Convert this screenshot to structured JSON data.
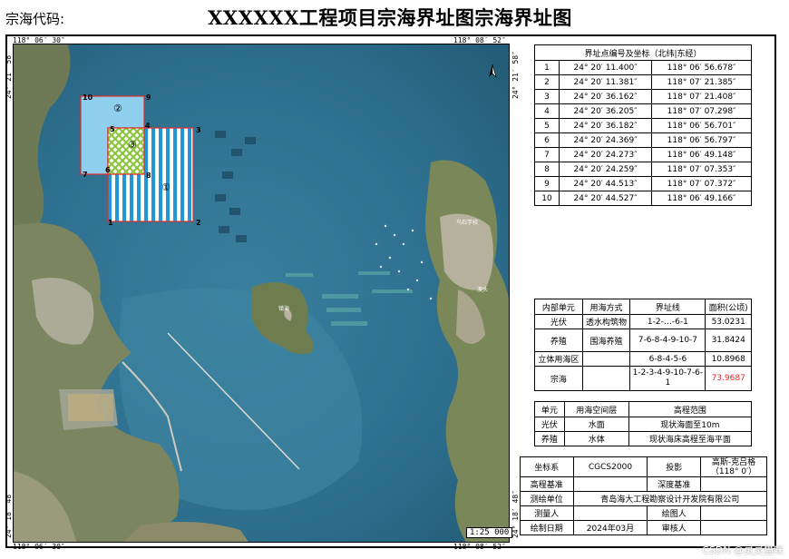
{
  "header": {
    "sea_code_label": "宗海代码:",
    "title": "XXXXXX工程项目宗海界址图宗海界址图"
  },
  "map": {
    "coords": {
      "top_left": "118° 06′ 30″",
      "top_right": "118° 08′ 52″",
      "bottom_left": "118° 06′ 30″",
      "bottom_right": "118° 08′ 52″",
      "left_top": "24° 21′ 58″",
      "left_bottom": "24° 18′ 48″",
      "right_top": "24° 21′ 58″",
      "right_bottom": "24° 18′ 48″"
    },
    "parcels": [
      {
        "id": "parcel-2",
        "label": "②",
        "fill": "#8ecfee"
      },
      {
        "id": "parcel-1",
        "label": "①",
        "fill": "#2196d8"
      },
      {
        "id": "parcel-3",
        "label": "③",
        "fill": "#8cc63f"
      }
    ],
    "points": [
      "1",
      "2",
      "3",
      "4",
      "5",
      "6",
      "7",
      "8",
      "9",
      "10"
    ],
    "place_labels": [
      "澳头",
      "镇海",
      "乌石学校"
    ],
    "scale": "1:25 000",
    "north_arrow": "north-arrow-icon"
  },
  "boundary_table": {
    "header": "界址点编号及坐标（北纬|东经）",
    "rows": [
      {
        "no": "1",
        "lat": "24° 20′ 11.400″",
        "lon": "118° 06′ 56.678″"
      },
      {
        "no": "2",
        "lat": "24° 20′ 11.381″",
        "lon": "118° 07′ 21.385″"
      },
      {
        "no": "3",
        "lat": "24° 20′ 36.162″",
        "lon": "118° 07′ 21.408″"
      },
      {
        "no": "4",
        "lat": "24° 20′ 36.205″",
        "lon": "118° 07′ 07.298″"
      },
      {
        "no": "5",
        "lat": "24° 20′ 36.182″",
        "lon": "118° 06′ 56.701″"
      },
      {
        "no": "6",
        "lat": "24° 20′ 24.369″",
        "lon": "118° 06′ 56.797″"
      },
      {
        "no": "7",
        "lat": "24° 20′ 24.273″",
        "lon": "118° 06′ 49.148″"
      },
      {
        "no": "8",
        "lat": "24° 20′ 24.259″",
        "lon": "118° 07′ 07.353″"
      },
      {
        "no": "9",
        "lat": "24° 20′ 44.513″",
        "lon": "118° 07′ 07.372″"
      },
      {
        "no": "10",
        "lat": "24° 20′ 44.527″",
        "lon": "118° 06′ 49.166″"
      }
    ]
  },
  "unit_table": {
    "headers": [
      "内部单元",
      "用海方式",
      "界址线",
      "面积(公顷)"
    ],
    "rows": [
      {
        "unit": "光伏",
        "method": "透水构筑物",
        "line": "1-2-…-6-1",
        "area": "53.0231"
      },
      {
        "unit": "养殖",
        "method": "围海养殖",
        "line": "7-6-8-4-9-10-7",
        "area": "31.8424"
      },
      {
        "unit": "立体用海区",
        "method": "",
        "line": "6-8-4-5-6",
        "area": "10.8968"
      },
      {
        "unit": "宗海",
        "method": "",
        "line": "1-2-3-4-9-10-7-6-1",
        "area": "73.9687"
      }
    ],
    "total_color": "#e8262b"
  },
  "space_table": {
    "headers": [
      "单元",
      "用海空间层",
      "高程范围"
    ],
    "rows": [
      {
        "unit": "光伏",
        "layer": "水面",
        "range": "现状海面至10m"
      },
      {
        "unit": "养殖",
        "layer": "水体",
        "range": "现状海床高程至海平面"
      }
    ]
  },
  "info_table": {
    "coord_sys_label": "坐标系",
    "coord_sys": "CGCS2000",
    "projection_label": "投影",
    "projection": "高斯-克吕格（118° 0′）",
    "elevation_label": "高程基准",
    "elevation": "",
    "depth_label": "深度基准",
    "depth": "",
    "survey_unit_label": "测绘单位",
    "survey_unit": "青岛海大工程勘察设计开发院有限公司",
    "surveyor_label": "测量人",
    "surveyor": "",
    "drafter_label": "绘图人",
    "drafter": "",
    "date_label": "绘制日期",
    "date": "2024年03月",
    "reviewer_label": "审核人",
    "reviewer": ""
  },
  "watermark": "CSDN @灵灵猫咪"
}
